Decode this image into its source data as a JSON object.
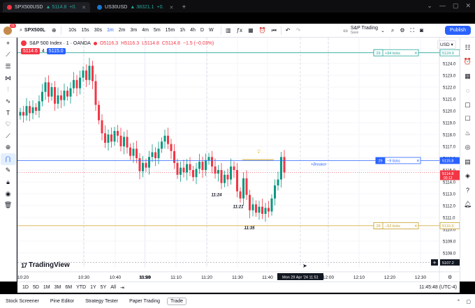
{
  "tabs": [
    {
      "symbol": "SPX500USD",
      "price": "▲ 5114.8",
      "change": "+0.",
      "close": "✕",
      "favicon_color": "#f23645",
      "active": true
    },
    {
      "symbol": "US30USD",
      "price": "▲ 38321.1",
      "change": "+0.",
      "close": "✕",
      "favicon_color": "#1976d2",
      "active": false
    }
  ],
  "new_tab": "+",
  "window_controls": [
    "⌄",
    "—",
    "▢",
    "✕"
  ],
  "toolbar": {
    "badge": "11",
    "symbol": "SPX500L",
    "timeframes": [
      "10s",
      "15s",
      "30s",
      "1m",
      "2m",
      "3m",
      "4m",
      "5m",
      "15m",
      "1h",
      "4h",
      "D",
      "W"
    ],
    "active_timeframe": "1m",
    "layout_name": "S&P Trading",
    "layout_sub": "Save",
    "publish": "Publish"
  },
  "left_tools": [
    "crosshair-icon",
    "trend-line-icon",
    "fib-icon",
    "pattern-icon",
    "ruler-icon",
    "path-icon",
    "text-icon",
    "heart-icon",
    "measure-icon",
    "zoom-icon",
    "magnet-icon",
    "lock-draw-icon",
    "lock-icon",
    "eye-icon",
    "trash-icon"
  ],
  "right_tools": [
    "watchlist-icon",
    "alerts-icon",
    "calendar-icon",
    "ideas-icon",
    "chat-icon",
    "notes-icon",
    "hotlist-icon",
    "indicators-icon",
    "dom-icon",
    "layers-icon",
    "help-icon",
    "notifications-icon"
  ],
  "legend": {
    "name": "S&P 500 Index · 1 · OANDA",
    "o": "O5116.3",
    "h": "H5116.3",
    "l": "L5114.8",
    "c": "C5114.8",
    "change": "−1.5 (−0.03%)"
  },
  "quote": {
    "sell": "5114.6",
    "spread": "4",
    "buy": "5115.0"
  },
  "currency": "USD ▾",
  "logo": "TradingView",
  "logo_mark": "17",
  "chart_data": {
    "type": "candlestick",
    "y_ticks": [
      5124.0,
      5123.0,
      5122.0,
      5121.0,
      5120.0,
      5119.0,
      5118.0,
      5117.0,
      5116.0,
      5115.0,
      5114.0,
      5113.0,
      5112.0,
      5111.0,
      5110.0,
      5109.0,
      5108.0
    ],
    "ylim": [
      5107.0,
      5125.0
    ],
    "x_ticks": [
      "10:20",
      "10:30",
      "10:40",
      "10:50",
      "11:00",
      "11:10",
      "11:20",
      "11:30",
      "11:40",
      "12:00",
      "12:10",
      "12:20",
      "12:30"
    ],
    "x_ticks_bold": [
      "11:00"
    ],
    "crosshair_time": "Mon 29 Apr '24  11:51",
    "crosshair_price": "5107.2",
    "current_price": "5114.8",
    "countdown": "00:12",
    "closes": [
      5119.9,
      5119.6,
      5120.4,
      5119.8,
      5120.3,
      5120.0,
      5120.8,
      5121.6,
      5122.4,
      5121.2,
      5122.0,
      5120.6,
      5121.3,
      5120.9,
      5121.7,
      5121.2,
      5121.9,
      5122.6,
      5121.9,
      5122.8,
      5123.4,
      5122.6,
      5123.8,
      5122.5,
      5120.5,
      5119.2,
      5118.1,
      5117.3,
      5118.0,
      5117.4,
      5118.3,
      5117.9,
      5117.0,
      5117.8,
      5116.9,
      5116.2,
      5116.8,
      5116.0,
      5114.9,
      5115.6,
      5115.2,
      5116.1,
      5116.5,
      5116.0,
      5116.8,
      5117.4,
      5117.9,
      5117.2,
      5116.6,
      5115.6,
      5114.6,
      5115.2,
      5114.8,
      5115.5,
      5115.0,
      5114.4,
      5115.1,
      5115.7,
      5115.0,
      5115.8,
      5116.1,
      5115.3,
      5114.7,
      5115.0,
      5113.9,
      5114.6,
      5114.2,
      5115.3,
      5115.0,
      5113.2,
      5112.6,
      5114.3,
      5112.9,
      5111.6,
      5112.1,
      5111.4,
      5111.9,
      5111.3,
      5111.8,
      5111.5,
      5112.6,
      5113.7,
      5114.2,
      5116.1,
      5114.8
    ],
    "annotations": [
      "11:24",
      "11:21",
      "11:35"
    ],
    "orders": [
      {
        "qty": "29",
        "label": "+94 ticks",
        "price": "5124.9",
        "color": "#26a69a"
      },
      {
        "qty": "29",
        "label": "−9 ticks",
        "price": "5115.8",
        "color": "#2962ff"
      },
      {
        "qty": "29",
        "label": "−52 ticks",
        "price": "5110.3",
        "color": "#c9a227"
      }
    ],
    "breaker_label": "+Breaker",
    "position_price": "5114.8"
  },
  "ranges": [
    "1D",
    "5D",
    "1M",
    "3M",
    "6M",
    "YTD",
    "1Y",
    "5Y",
    "All"
  ],
  "clock": "11:45:48 (UTC-4)",
  "panels": [
    "Stock Screener",
    "Pine Editor",
    "Strategy Tester",
    "Paper Trading",
    "Trade"
  ],
  "panel_controls": [
    "⌃",
    "▢"
  ]
}
